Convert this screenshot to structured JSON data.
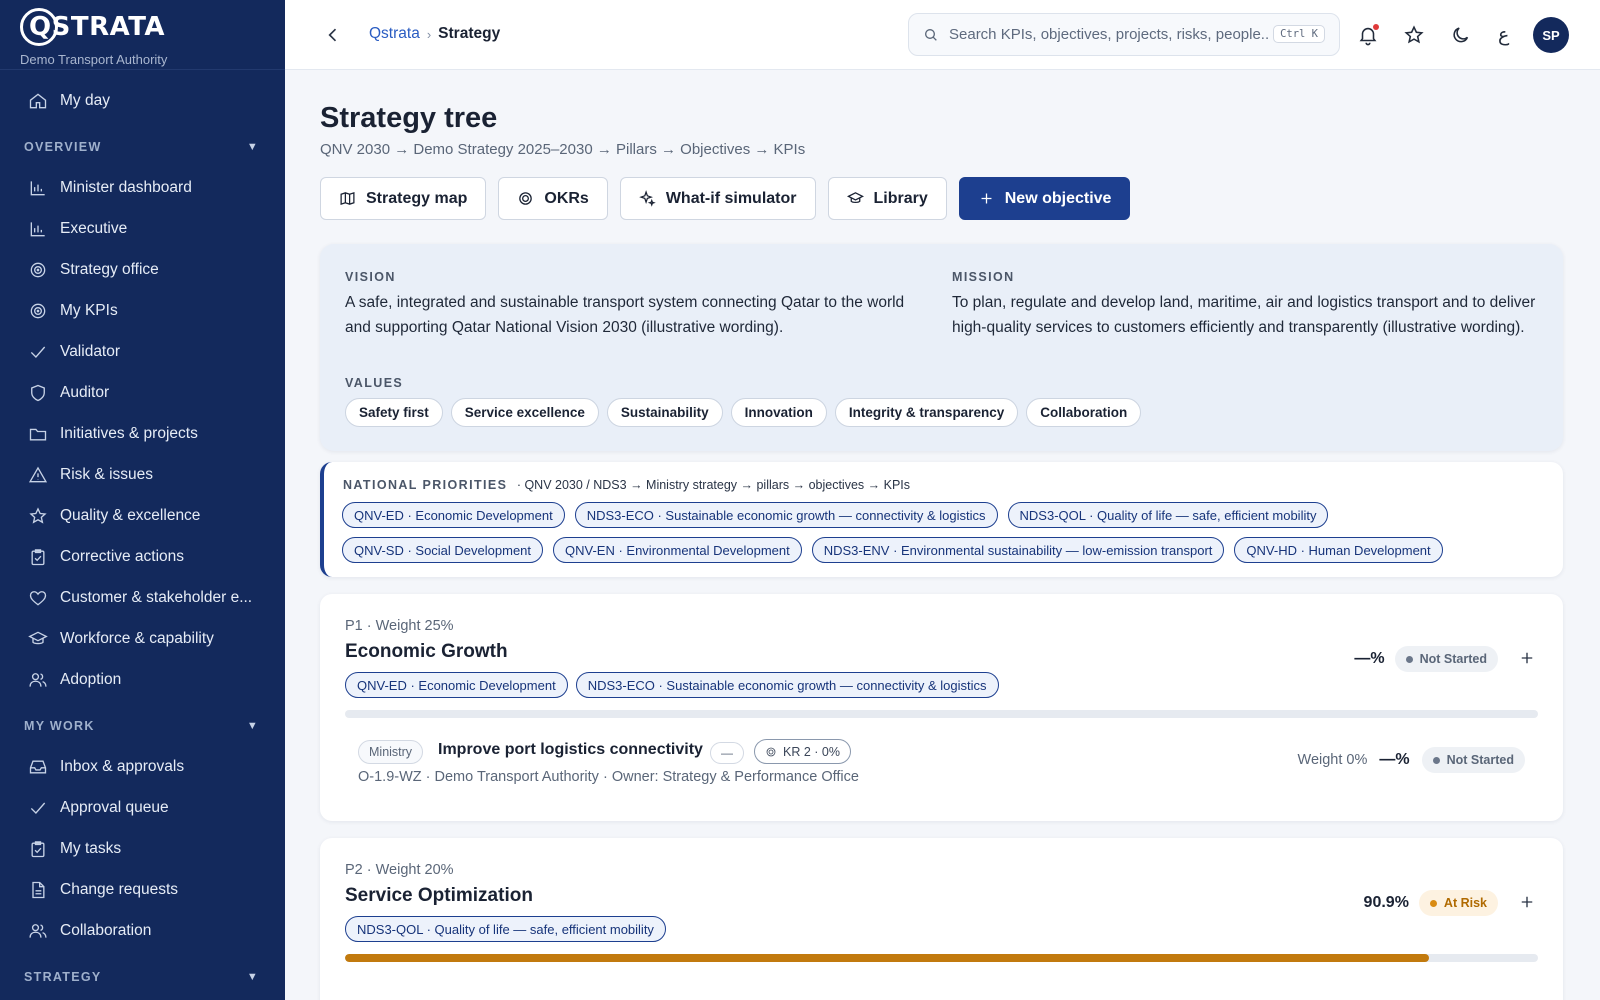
{
  "brand": {
    "logo": "QSTRATA",
    "org": "Demo Transport Authority"
  },
  "sidebar": {
    "top_item": {
      "label": "My day",
      "icon": "home-icon"
    },
    "sections": [
      {
        "title": "OVERVIEW",
        "items": [
          {
            "label": "Minister dashboard",
            "icon": "bar-chart-icon"
          },
          {
            "label": "Executive",
            "icon": "bar-chart-icon"
          },
          {
            "label": "Strategy office",
            "icon": "target-icon"
          },
          {
            "label": "My KPIs",
            "icon": "target-icon"
          },
          {
            "label": "Validator",
            "icon": "check-icon"
          },
          {
            "label": "Auditor",
            "icon": "shield-icon"
          },
          {
            "label": "Initiatives & projects",
            "icon": "folder-icon"
          },
          {
            "label": "Risk & issues",
            "icon": "warning-icon"
          },
          {
            "label": "Quality & excellence",
            "icon": "star-icon"
          },
          {
            "label": "Corrective actions",
            "icon": "clipboard-check-icon"
          },
          {
            "label": "Customer & stakeholder e...",
            "icon": "heart-icon"
          },
          {
            "label": "Workforce & capability",
            "icon": "graduation-cap-icon"
          },
          {
            "label": "Adoption",
            "icon": "users-icon"
          }
        ]
      },
      {
        "title": "MY WORK",
        "items": [
          {
            "label": "Inbox & approvals",
            "icon": "inbox-icon"
          },
          {
            "label": "Approval queue",
            "icon": "check-icon"
          },
          {
            "label": "My tasks",
            "icon": "clipboard-check-icon"
          },
          {
            "label": "Change requests",
            "icon": "document-icon"
          },
          {
            "label": "Collaboration",
            "icon": "users-icon"
          }
        ]
      },
      {
        "title": "STRATEGY",
        "items": []
      }
    ]
  },
  "topbar": {
    "breadcrumb": {
      "root": "Qstrata",
      "separator": "›",
      "current": "Strategy"
    },
    "search": {
      "placeholder": "Search KPIs, objectives, projects, risks, people...",
      "shortcut": "Ctrl K"
    },
    "language": "ع",
    "avatar": "SP"
  },
  "page": {
    "title": "Strategy tree",
    "path": "QNV 2030 → Demo Strategy 2025–2030 → Pillars → Objectives → KPIs",
    "actions": {
      "strategy_map": "Strategy map",
      "okrs": "OKRs",
      "what_if": "What-if simulator",
      "library": "Library",
      "new_objective": "New objective"
    }
  },
  "vision_mission": {
    "vision_label": "VISION",
    "vision": "A safe, integrated and sustainable transport system connecting Qatar to the world and supporting Qatar National Vision 2030 (illustrative wording).",
    "mission_label": "MISSION",
    "mission": "To plan, regulate and develop land, maritime, air and logistics transport and to deliver high-quality services to customers efficiently and transparently (illustrative wording).",
    "values_label": "VALUES",
    "values": [
      "Safety first",
      "Service excellence",
      "Sustainability",
      "Innovation",
      "Integrity & transparency",
      "Collaboration"
    ]
  },
  "national_priorities": {
    "label": "NATIONAL PRIORITIES",
    "description": "· QNV 2030 / NDS3 → Ministry strategy → pillars → objectives → KPIs",
    "rows": [
      [
        "QNV-ED · Economic Development",
        "NDS3-ECO · Sustainable economic growth — connectivity & logistics",
        "NDS3-QOL · Quality of life — safe, efficient mobility"
      ],
      [
        "QNV-SD · Social Development",
        "QNV-EN · Environmental Development",
        "NDS3-ENV · Environmental sustainability — low-emission transport",
        "QNV-HD · Human Development"
      ]
    ]
  },
  "pillars": [
    {
      "meta": "P1 · Weight 25%",
      "name": "Economic Growth",
      "tags": [
        "QNV-ED · Economic Development",
        "NDS3-ECO · Sustainable economic growth — connectivity & logistics"
      ],
      "percent": "—%",
      "progress": 0,
      "status": "Not Started",
      "objective": {
        "level": "Ministry",
        "name": "Improve port logistics connectivity",
        "dash": "—",
        "kr": "KR 2 · 0%",
        "meta": "O-1.9-WZ · Demo Transport Authority · Owner: Strategy & Performance Office",
        "weight": "Weight 0%",
        "percent": "—%",
        "status": "Not Started"
      }
    },
    {
      "meta": "P2 · Weight 20%",
      "name": "Service Optimization",
      "tags": [
        "NDS3-QOL · Quality of life — safe, efficient mobility"
      ],
      "percent": "90.9%",
      "progress": 90.9,
      "status": "At Risk"
    }
  ]
}
